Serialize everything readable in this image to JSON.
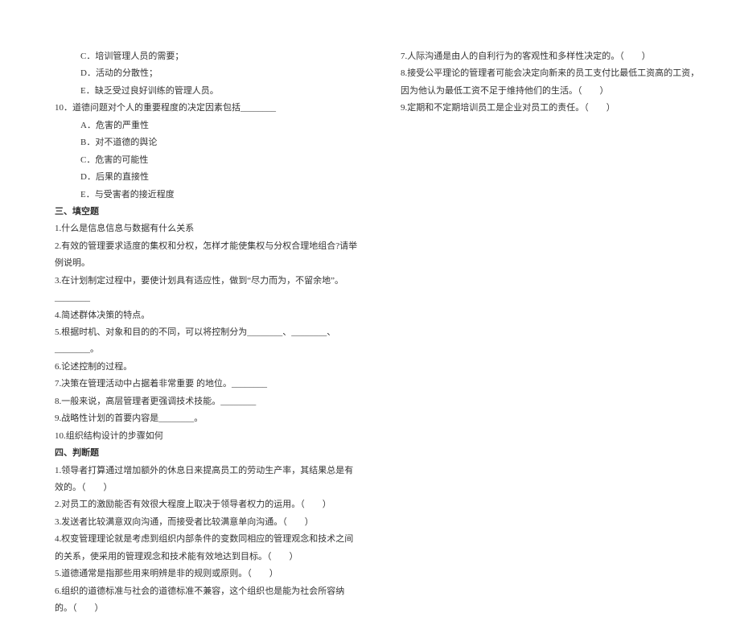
{
  "left": {
    "options_before": [
      "C．培训管理人员的需要；",
      "D．活动的分散性；",
      "E．缺乏受过良好训练的管理人员。"
    ],
    "q10": {
      "stem": "10．道德问题对个人的重要程度的决定因素包括________",
      "options": [
        "A．危害的严重性",
        "B．对不道德的舆论",
        "C．危害的可能性",
        "D．后果的直接性",
        "E．与受害者的接近程度"
      ]
    },
    "section3_title": "三、填空题",
    "section3": [
      "1.什么是信息信息与数据有什么关系",
      "2.有效的管理要求适度的集权和分权，怎样才能使集权与分权合理地组合?请举例说明。",
      "3.在计划制定过程中，要使计划具有适应性，做到“尽力而为，不留余地”。________",
      "4.简述群体决策的特点。",
      "5.根据时机、对象和目的的不同，可以将控制分为________、________、________。",
      "6.论述控制的过程。",
      "7.决策在管理活动中占据着非常重要   的地位。________",
      "8.一般来说，高层管理者更强调技术技能。________",
      "9.战略性计划的首要内容是________。",
      "10.组织结构设计的步骤如何"
    ],
    "section4_title": "四、判断题",
    "section4": [
      "1.领导者打算通过增加额外的休息日来提高员工的劳动生产率，其结果总是有效的。（　　）",
      "2.对员工的激励能否有效很大程度上取决于领导者权力的运用。（　　）",
      "3.发送者比较满意双向沟通，而接受者比较满意单向沟通。（　　）",
      "4.权变管理理论就是考虑到组织内部条件的变数同相应的管理观念和技术之间的关系，使采用的管理观念和技术能有效地达到目标。（　　）",
      "5.道德通常是指那些用来明辨是非的规则或原则。（　　）",
      "6.组织的道德标准与社会的道德标准不兼容，这个组织也是能为社会所容纳的。（　　）"
    ]
  },
  "right": {
    "items": [
      "7.人际沟通是由人的自利行为的客观性和多样性决定的。（　　）",
      "8.接受公平理论的管理者可能会决定向新来的员工支付比最低工资高的工资，因为他认为最低工资不足于维持他们的生活。（　　）",
      "9.定期和不定期培训员工是企业对员工的责任。（　　）"
    ]
  }
}
